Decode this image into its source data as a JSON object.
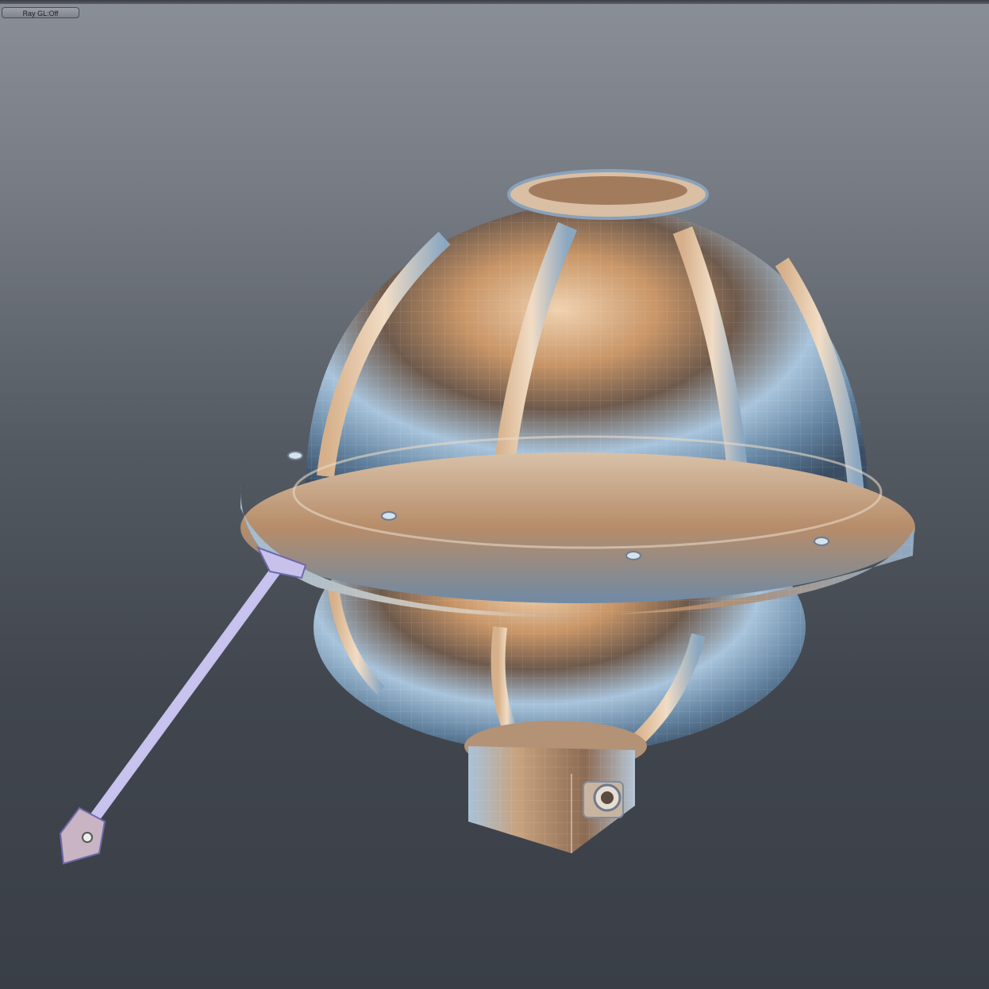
{
  "viewport": {
    "raygl_button_label": "Ray GL:Off"
  },
  "colors": {
    "bg_top": "#8a8f97",
    "bg_bottom": "#3a3f47",
    "metal_copper": "#c9986a",
    "metal_blue": "#8fb3cf",
    "rod_lavender": "#a9a3d8"
  },
  "scene": {
    "object": "copper-sphere-lamp-model",
    "display_mode": "wireframe-shaded"
  }
}
